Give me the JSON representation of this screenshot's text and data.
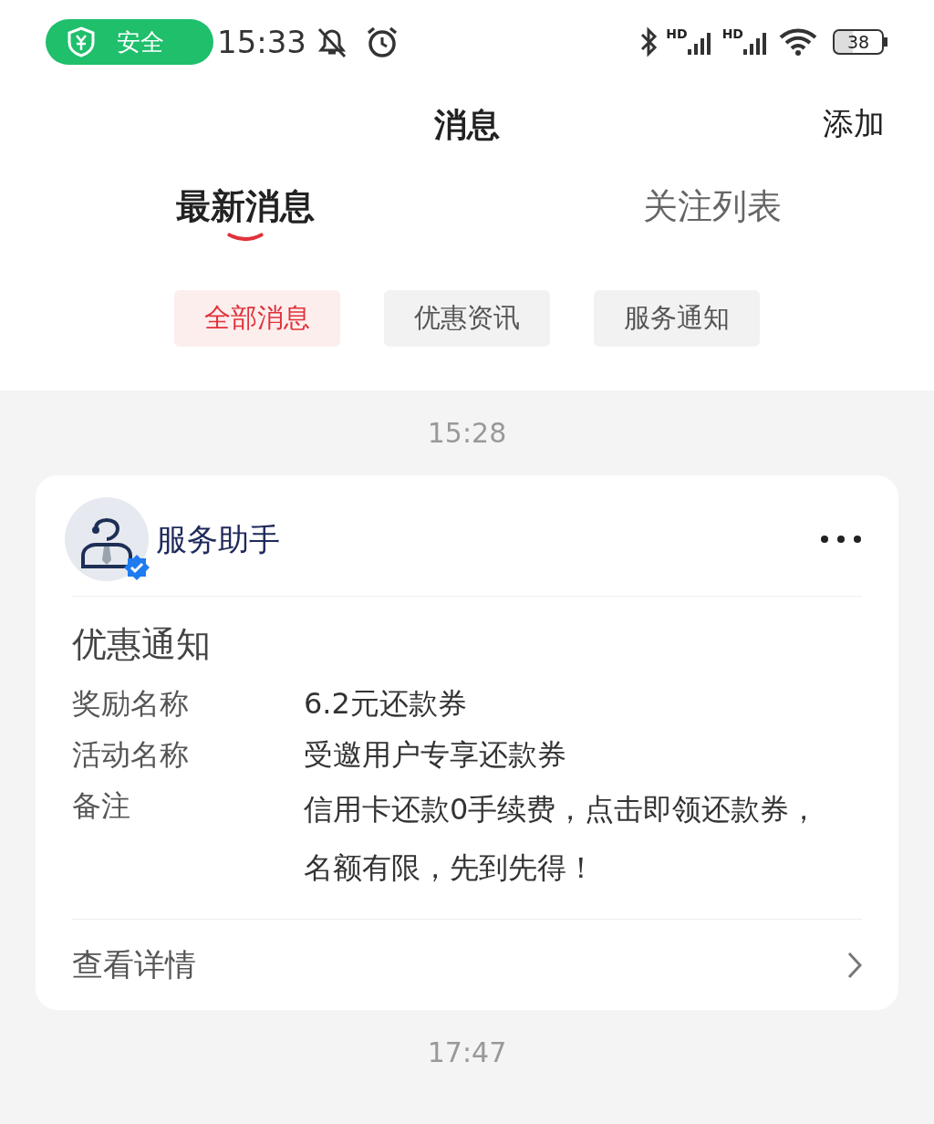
{
  "status_bar": {
    "security_label": "安全",
    "time": "15:33",
    "signal_labels": [
      "HD",
      "HD"
    ],
    "battery": "38"
  },
  "header": {
    "title": "消息",
    "action": "添加"
  },
  "tabs": [
    {
      "label": "最新消息",
      "selected": true
    },
    {
      "label": "关注列表",
      "selected": false
    }
  ],
  "filters": [
    {
      "label": "全部消息",
      "selected": true
    },
    {
      "label": "优惠资讯",
      "selected": false
    },
    {
      "label": "服务通知",
      "selected": false
    }
  ],
  "messages": [
    {
      "time": "15:28",
      "sender": "服务助手",
      "category": "优惠通知",
      "fields": [
        {
          "label": "奖励名称",
          "value": "6.2元还款券"
        },
        {
          "label": "活动名称",
          "value": "受邀用户专享还款券"
        },
        {
          "label": "备注",
          "value": "信用卡还款0手续费，点击即领还款券，名额有限，先到先得！"
        }
      ],
      "link": "查看详情"
    }
  ],
  "next_time": "17:47"
}
